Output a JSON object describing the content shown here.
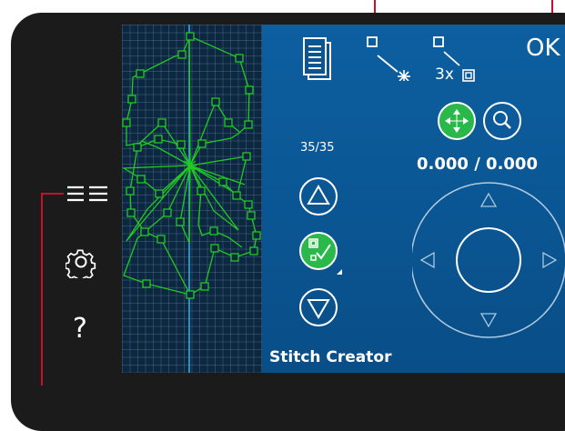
{
  "sidebar": {
    "menu_icon": "hamburger-list-icon",
    "settings_icon": "gear-icon",
    "help_label": "?"
  },
  "toolbar": {
    "select_point_icon": "select-point-icon",
    "triple_stitch_label": "3x",
    "ok_label": "OK",
    "document_icon": "document-icon"
  },
  "controls": {
    "stitch_counter": "35/35",
    "coordinates": "0.000 / 0.000",
    "move_icon": "move-arrows-icon",
    "zoom_icon": "magnifier-icon",
    "step_up_icon": "triangle-up-icon",
    "step_down_icon": "triangle-down-icon",
    "select_icon": "check-select-icon",
    "wheel_icon": "direction-wheel-icon"
  },
  "app_title": "Stitch Creator",
  "colors": {
    "panel_blue": "#0a5592",
    "grid_bg": "#0c2740",
    "stitch_green": "#22c922",
    "callout_red": "#c8102e",
    "device_dark": "#1b1b1b"
  }
}
